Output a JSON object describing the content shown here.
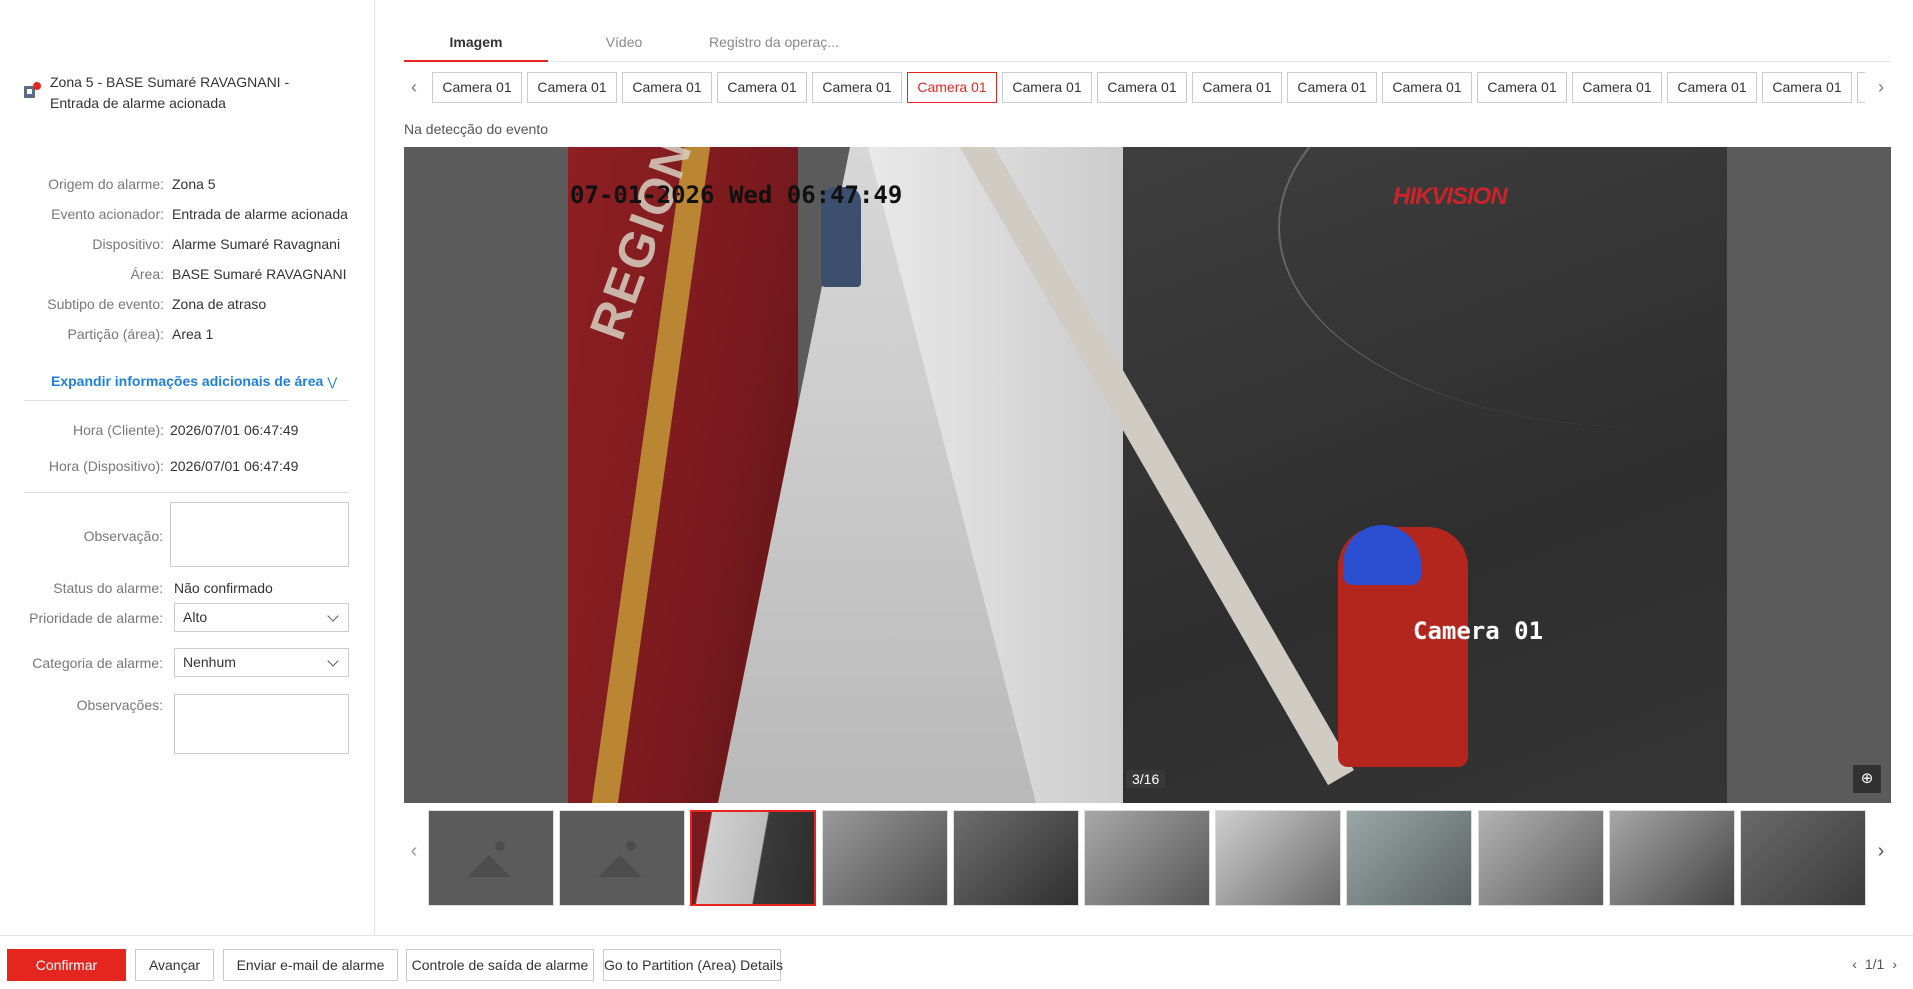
{
  "alarm": {
    "title": "Zona 5 - BASE Sumaré RAVAGNANI - Entrada de alarme acionada",
    "details": [
      {
        "label": "Origem do alarme:",
        "value": "Zona 5"
      },
      {
        "label": "Evento acionador:",
        "value": "Entrada de alarme acionada"
      },
      {
        "label": "Dispositivo:",
        "value": "Alarme Sumaré Ravagnani"
      },
      {
        "label": "Área:",
        "value": "BASE Sumaré RAVAGNANI"
      },
      {
        "label": "Subtipo de evento:",
        "value": "Zona de atraso"
      },
      {
        "label": "Partição (área):",
        "value": "Area 1"
      }
    ],
    "expand_label": "Expandir informações adicionais de área",
    "times": [
      {
        "label": "Hora (Cliente):",
        "value": "2026/07/01 06:47:49"
      },
      {
        "label": "Hora (Dispositivo):",
        "value": "2026/07/01 06:47:49"
      }
    ]
  },
  "form": {
    "observation_label": "Observação:",
    "status_label": "Status do alarme:",
    "status_value": "Não confirmado",
    "priority_label": "Prioridade de alarme:",
    "priority_value": "Alto",
    "category_label": "Categoria de alarme:",
    "category_value": "Nenhum",
    "remarks_label": "Observações:"
  },
  "tabs": [
    {
      "label": "Imagem",
      "active": true
    },
    {
      "label": "Vídeo",
      "active": false
    },
    {
      "label": "Registro da operaç...",
      "active": false
    }
  ],
  "cameras": [
    "Camera 01",
    "Camera 01",
    "Camera 01",
    "Camera 01",
    "Camera 01",
    "Camera 01",
    "Camera 01",
    "Camera 01",
    "Camera 01",
    "Camera 01",
    "Camera 01",
    "Camera 01",
    "Camera 01",
    "Camera 01",
    "Camera 01"
  ],
  "selected_camera_index": 5,
  "event_label": "Na detecção do evento",
  "viewer": {
    "osd_time": "07-01-2026 Wed 06:47:49",
    "osd_brand": "HIKVISION",
    "osd_camera": "Camera 01",
    "counter": "3/16"
  },
  "thumbnails": {
    "count": 11,
    "selected_index": 2,
    "placeholders": [
      0,
      1
    ]
  },
  "footer": {
    "confirm": "Confirmar",
    "next": "Avançar",
    "email": "Enviar e-mail de alarme",
    "output": "Controle de saída de alarme",
    "partition": "Go to Partition (Area) Details",
    "pager": "1/1"
  }
}
